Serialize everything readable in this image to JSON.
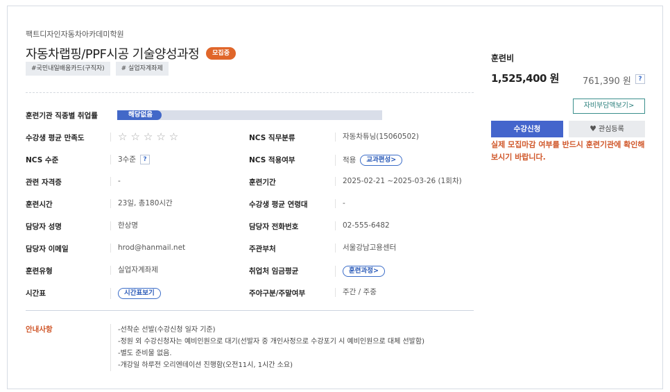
{
  "header": {
    "academy": "팩트디자인자동차아카데미학원",
    "title": "자동차랩핑/PPF시공 기술양성과정",
    "status_badge": "모집중",
    "tags": [
      "#국민내일배움카드(구직자)",
      "# 실업자계좌제"
    ]
  },
  "info": {
    "employment_rate": {
      "label": "훈련기관 직종별 취업률",
      "value": "해당없음"
    },
    "satisfaction": {
      "label": "수강생 평균 만족도",
      "stars_filled": 0,
      "stars_total": 5
    },
    "ncs_category": {
      "label": "NCS 직무분류",
      "value": "자동차튜닝(15060502)"
    },
    "ncs_level": {
      "label": "NCS 수준",
      "value": "3수준",
      "help": "?"
    },
    "ncs_applied": {
      "label": "NCS 적용여부",
      "value": "적용",
      "button": "교과편성>"
    },
    "certificate": {
      "label": "관련 자격증",
      "value": "-"
    },
    "period": {
      "label": "훈련기간",
      "value": "2025-02-21 ~2025-03-26 (1회차)"
    },
    "hours": {
      "label": "훈련시간",
      "value": "23일, 총180시간"
    },
    "avg_age": {
      "label": "수강생 평균 연령대",
      "value": "-"
    },
    "manager_name": {
      "label": "담당자 성명",
      "value": "한상명"
    },
    "manager_phone": {
      "label": "담당자 전화번호",
      "value": "02-555-6482"
    },
    "manager_email": {
      "label": "담당자 이메일",
      "value": "hrod@hanmail.net"
    },
    "department": {
      "label": "주관부처",
      "value": "서울강남고용센터"
    },
    "training_type": {
      "label": "훈련유형",
      "value": "실업자계좌제"
    },
    "avg_wage": {
      "label": "취업처 임금평균",
      "button": "훈련과정>"
    },
    "timetable": {
      "label": "시간표",
      "button": "시간표보기"
    },
    "day_type": {
      "label": "주야구분/주말여부",
      "value": "주간 / 주중"
    }
  },
  "notice": {
    "label": "안내사항",
    "lines": [
      "-선착순 선발(수강신청 일자 기준)",
      "-정원 외 수강신청자는 예비인원으로 대기(선발자 중 개인사정으로 수강포기 시 예비인원으로 대체 선발함)",
      "-별도 준비물 없음.",
      "-개강일 하루전 오리엔테이션 진행함(오전11시, 1시간 소요)"
    ]
  },
  "side": {
    "fee_label": "훈련비",
    "fee_total": "1,525,400 원",
    "fee_self": "761,390 원",
    "fee_help": "?",
    "self_pay_button": "자비부담액보기>",
    "apply_button": "수강신청",
    "wish_button": "관심등록",
    "warning": "실제 모집마감 여부를 반드시 훈련기관에 확인해보시기 바랍니다."
  },
  "icons": {
    "star": "star-outline-icon",
    "heart": "heart-icon",
    "help": "question-icon"
  },
  "colors": {
    "accent_blue": "#4465cc",
    "badge_orange": "#e0662a",
    "warning_orange": "#d0572a",
    "teal": "#2b7f7c"
  }
}
